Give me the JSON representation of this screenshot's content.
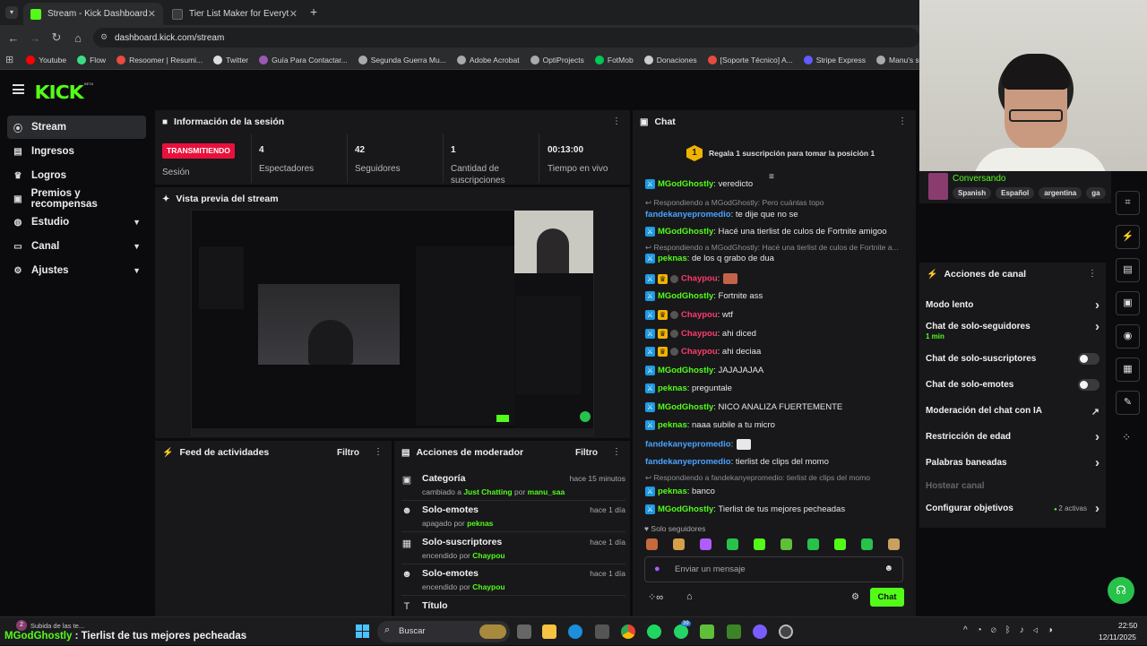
{
  "browser": {
    "tabs": [
      {
        "label": "Stream - Kick Dashboard",
        "color": "#53fc18"
      },
      {
        "label": "Tier List Maker for Everything -",
        "color": "#333333"
      }
    ],
    "url": "dashboard.kick.com/stream",
    "bookmarks": [
      {
        "label": "Youtube",
        "color": "#ff0000"
      },
      {
        "label": "Flow",
        "color": "#3ddc84"
      },
      {
        "label": "Resoomer | Resumi...",
        "color": "#e74c3c"
      },
      {
        "label": "Twitter",
        "color": "#dddddd"
      },
      {
        "label": "Guía Para Contactar...",
        "color": "#9b59b6"
      },
      {
        "label": "Segunda Guerra Mu...",
        "color": "#aaaaaa"
      },
      {
        "label": "Adobe Acrobat",
        "color": "#aaaaaa"
      },
      {
        "label": "OptiProjects",
        "color": "#aaaaaa"
      },
      {
        "label": "FotMob",
        "color": "#00c853"
      },
      {
        "label": "Donaciones",
        "color": "#cccccc"
      },
      {
        "label": "[Soporte Técnico] A...",
        "color": "#e74c3c"
      },
      {
        "label": "Stripe Express",
        "color": "#635bff"
      },
      {
        "label": "Manu's stats, strea...",
        "color": "#aaaaaa"
      }
    ]
  },
  "app": {
    "logo": "KICK",
    "beta": "BETA"
  },
  "sidebar": {
    "items": [
      {
        "label": "Stream",
        "icon": "broadcast-icon"
      },
      {
        "label": "Ingresos",
        "icon": "receipt-icon"
      },
      {
        "label": "Logros",
        "icon": "trophy-icon"
      },
      {
        "label": "Premios y recompensas",
        "icon": "gift-icon"
      },
      {
        "label": "Estudio",
        "icon": "studio-icon"
      },
      {
        "label": "Canal",
        "icon": "channel-icon"
      },
      {
        "label": "Ajustes",
        "icon": "gear-icon"
      }
    ]
  },
  "session": {
    "title": "Información de la sesión",
    "status_badge": "TRANSMITIENDO",
    "status_label": "Sesión",
    "stats": [
      {
        "value": "4",
        "label": "Espectadores"
      },
      {
        "value": "42",
        "label": "Seguidores"
      },
      {
        "value": "1",
        "label": "Cantidad de suscripciones"
      },
      {
        "value": "00:13:00",
        "label": "Tiempo en vivo"
      }
    ]
  },
  "preview": {
    "title": "Vista previa del stream"
  },
  "feed": {
    "title": "Feed de actividades",
    "filter": "Filtro"
  },
  "mod": {
    "title": "Acciones de moderador",
    "filter": "Filtro",
    "actions": [
      {
        "title": "Categoría",
        "time": "hace 15 minutos",
        "pre": "cambiado a ",
        "target": "Just Chatting",
        "mid": " por ",
        "user": "manu_saa",
        "icon": "category-icon"
      },
      {
        "title": "Solo-emotes",
        "time": "hace 1 día",
        "pre": "apagado por ",
        "target": "",
        "mid": "",
        "user": "peknas",
        "icon": "emote-icon"
      },
      {
        "title": "Solo-suscriptores",
        "time": "hace 1 día",
        "pre": "encendido por ",
        "target": "",
        "mid": "",
        "user": "Chaypou",
        "icon": "gift-icon"
      },
      {
        "title": "Solo-emotes",
        "time": "hace 1 día",
        "pre": "encendido por ",
        "target": "",
        "mid": "",
        "user": "Chaypou",
        "icon": "emote-icon"
      },
      {
        "title": "Título",
        "time": "",
        "pre": "",
        "target": "",
        "mid": "",
        "user": "",
        "icon": "title-icon"
      }
    ]
  },
  "chat": {
    "title": "Chat",
    "gift_banner": "Regala 1 suscripción para tomar la posición 1",
    "gift_rank": "1",
    "messages": [
      {
        "kind": "msg",
        "user": "MGodGhostly",
        "color": "#53fc18",
        "badges": [
          "mod"
        ],
        "text": ": veredicto"
      },
      {
        "kind": "reply",
        "text": "Respondiendo a MGodGhostly: Pero cuántas topo"
      },
      {
        "kind": "msg",
        "user": "fandekanyepromedio",
        "color": "#4aa3ff",
        "badges": [],
        "text": ": te dije que no se"
      },
      {
        "kind": "msg",
        "user": "MGodGhostly",
        "color": "#53fc18",
        "badges": [
          "mod"
        ],
        "text": ": Hacé una tierlist de culos de Fortnite amigoo"
      },
      {
        "kind": "reply",
        "text": "Respondiendo a MGodGhostly: Hacé una tierlist de culos de Fortnite a..."
      },
      {
        "kind": "msg",
        "user": "peknas",
        "color": "#53fc18",
        "badges": [
          "mod"
        ],
        "text": ": de los q grabo de dua"
      },
      {
        "kind": "msg",
        "user": "Chaypou",
        "color": "#ff3b6b",
        "badges": [
          "mod",
          "crown",
          "dot"
        ],
        "text": ":",
        "emote": true
      },
      {
        "kind": "msg",
        "user": "MGodGhostly",
        "color": "#53fc18",
        "badges": [
          "mod"
        ],
        "text": ": Fortnite ass"
      },
      {
        "kind": "msg",
        "user": "Chaypou",
        "color": "#ff3b6b",
        "badges": [
          "mod",
          "crown",
          "dot"
        ],
        "text": ": wtf"
      },
      {
        "kind": "msg",
        "user": "Chaypou",
        "color": "#ff3b6b",
        "badges": [
          "mod",
          "crown",
          "dot"
        ],
        "text": ": ahi diced"
      },
      {
        "kind": "msg",
        "user": "Chaypou",
        "color": "#ff3b6b",
        "badges": [
          "mod",
          "crown",
          "dot"
        ],
        "text": ": ahi deciaa"
      },
      {
        "kind": "msg",
        "user": "MGodGhostly",
        "color": "#53fc18",
        "badges": [
          "mod"
        ],
        "text": ": JAJAJAJAA"
      },
      {
        "kind": "msg",
        "user": "peknas",
        "color": "#53fc18",
        "badges": [
          "mod"
        ],
        "text": ": preguntale"
      },
      {
        "kind": "msg",
        "user": "MGodGhostly",
        "color": "#53fc18",
        "badges": [
          "mod"
        ],
        "text": ": NICO ANALIZA FUERTEMENTE"
      },
      {
        "kind": "msg",
        "user": "peknas",
        "color": "#53fc18",
        "badges": [
          "mod"
        ],
        "text": ": naaa subile a tu micro"
      },
      {
        "kind": "msg",
        "user": "fandekanyepromedio",
        "color": "#4aa3ff",
        "badges": [],
        "text": ":",
        "emote": true
      },
      {
        "kind": "msg",
        "user": "fandekanyepromedio",
        "color": "#4aa3ff",
        "badges": [],
        "text": ": tierlist de clips del momo"
      },
      {
        "kind": "reply",
        "text": "Respondiendo a fandekanyepromedio: tierlist de clips del momo"
      },
      {
        "kind": "msg",
        "user": "peknas",
        "color": "#53fc18",
        "badges": [
          "mod"
        ],
        "text": ": banco"
      },
      {
        "kind": "msg",
        "user": "MGodGhostly",
        "color": "#53fc18",
        "badges": [
          "mod"
        ],
        "text": ": Tierlist de tus mejores pecheadas"
      }
    ],
    "followers_only": "Solo seguidores",
    "input_placeholder": "Enviar un mensaje",
    "send": "Chat"
  },
  "stream_info": {
    "status": "Conversando",
    "tags": [
      "Spanish",
      "Español",
      "argentina",
      "ga"
    ]
  },
  "channel_actions": {
    "title": "Acciones de canal",
    "items": [
      {
        "label": "Modo lento",
        "control": "chevron"
      },
      {
        "label": "Chat de solo-seguidores",
        "sub": "1 min",
        "control": "chevron"
      },
      {
        "label": "Chat de solo-suscriptores",
        "control": "toggle"
      },
      {
        "label": "Chat de solo-emotes",
        "control": "toggle"
      },
      {
        "label": "Moderación del chat con IA",
        "control": "external"
      },
      {
        "label": "Restricción de edad",
        "control": "chevron"
      },
      {
        "label": "Palabras baneadas",
        "control": "chevron"
      },
      {
        "label": "Hostear canal",
        "control": "none",
        "disabled": true
      },
      {
        "label": "Configurar objetivos",
        "control": "chevron",
        "extra": "2 activas"
      }
    ]
  },
  "notification": {
    "small": "Subida de las te...",
    "user": "MGodGhostly",
    "text": " : Tierlist de tus mejores pecheadas",
    "count": "2"
  },
  "taskbar": {
    "search": "Buscar",
    "time": "22:50",
    "date": "12/11/2025",
    "badge": "39"
  },
  "colors": {
    "accent": "#53fc18",
    "live": "#e9113c"
  }
}
